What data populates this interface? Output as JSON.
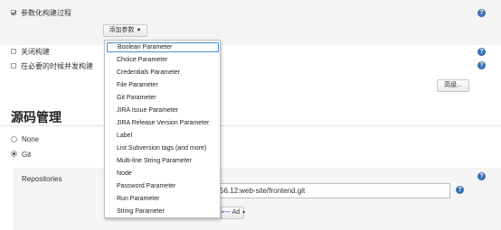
{
  "build": {
    "parameterized_label": "参数化构建过程",
    "add_param_button": "添加参数",
    "disable_build_label": "关闭构建",
    "concurrent_build_label": "在必要的时候并发构建",
    "advanced_button": "高级..."
  },
  "source": {
    "section_title": "源码管理",
    "scm_none": "None",
    "scm_git": "Git",
    "repositories_label": "Repositories",
    "repo_url_value": "56.12:web-site/frontend.git",
    "add_button": "Ad"
  },
  "dropdown": {
    "items": [
      "Boolean Parameter",
      "Choice Parameter",
      "Credentials Parameter",
      "File Parameter",
      "Git Parameter",
      "JIRA Issue Parameter",
      "JIRA Release Version Parameter",
      "Label",
      "List Subversion tags (and more)",
      "Multi-line String Parameter",
      "Node",
      "Password Parameter",
      "Run Parameter",
      "String Parameter"
    ]
  },
  "colors": {
    "accent": "#4a90d9",
    "help_icon": "#3a6fb0",
    "band": "#f4f4f4"
  },
  "icons": {
    "help": "help-icon",
    "dropdown": "caret-down-icon",
    "add": "arrow-left-icon"
  }
}
